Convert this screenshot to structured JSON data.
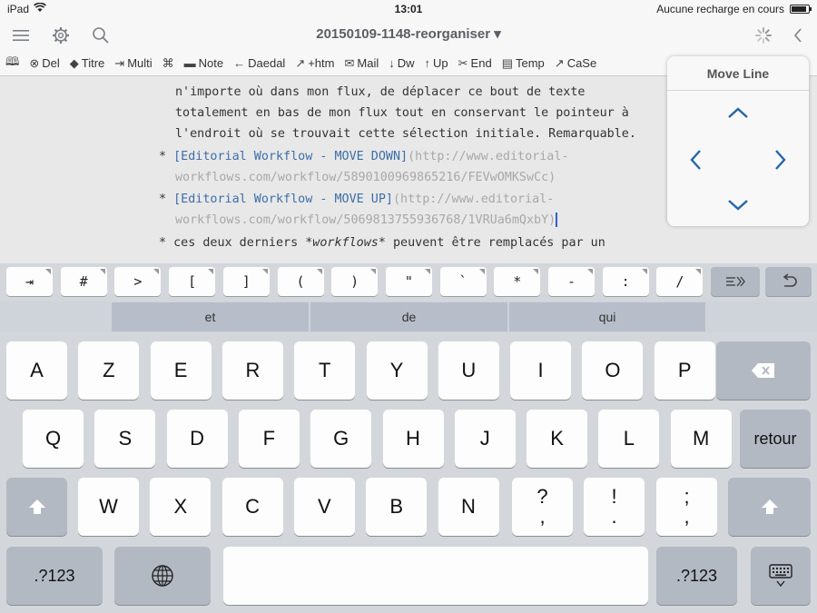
{
  "status": {
    "device": "iPad",
    "time": "13:01",
    "battery": "Aucune recharge en cours",
    "battery_fill": 0.9
  },
  "nav": {
    "title": "20150109-1148-reorganiser"
  },
  "toolbar": {
    "items": [
      {
        "icon": "book-icon",
        "label": ""
      },
      {
        "icon": "delete-circle-icon",
        "label": "Del"
      },
      {
        "icon": "tag-icon",
        "label": "Titre"
      },
      {
        "icon": "multi-icon",
        "label": "Multi"
      },
      {
        "icon": "edit-command-icon",
        "label": ""
      },
      {
        "icon": "speech-bubble-icon",
        "label": "Note"
      },
      {
        "icon": "back-arrow-icon",
        "label": "Daedal"
      },
      {
        "icon": "pin-icon",
        "label": "+htm"
      },
      {
        "icon": "mail-icon",
        "label": "Mail"
      },
      {
        "icon": "arrow-down-icon",
        "label": "Dw"
      },
      {
        "icon": "arrow-up-icon",
        "label": "Up"
      },
      {
        "icon": "scissors-icon",
        "label": "End"
      },
      {
        "icon": "clipboard-icon",
        "label": "Temp"
      },
      {
        "icon": "chart-icon",
        "label": "CaSe"
      }
    ]
  },
  "editor": {
    "line1": "n'importe où dans mon flux, de déplacer ce bout de texte",
    "line2": "totalement en bas de mon flux tout en conservant le pointeur à",
    "line3": "l'endroit où se trouvait cette sélection initiale. Remarquable.",
    "item1_bullet": "* ",
    "item1_link": "[Editorial Workflow - MOVE DOWN]",
    "item1_url_a": "(http://www.editorial-",
    "item1_url_b": "workflows.com/workflow/5890100969865216/FEVwOMKSwCc)",
    "item2_bullet": "* ",
    "item2_link": "[Editorial Workflow - MOVE UP]",
    "item2_url_a": "(http://www.editorial-",
    "item2_url_b": "workflows.com/workflow/5069813755936768/1VRUa6mQxbY)",
    "item3_bullet": "* ",
    "item3_pre": "ces deux derniers ",
    "item3_em": "*workflows*",
    "item3_post": " peuvent être remplacés par un"
  },
  "popover": {
    "title": "Move Line"
  },
  "accessory_keys": [
    "⇥",
    "#",
    ">",
    "[",
    "]",
    "(",
    ")",
    "\"",
    "`",
    "*",
    "-",
    ":",
    "/"
  ],
  "predictions": [
    "et",
    "de",
    "qui"
  ],
  "keyboard": {
    "row1": [
      "A",
      "Z",
      "E",
      "R",
      "T",
      "Y",
      "U",
      "I",
      "O",
      "P"
    ],
    "row2": [
      "Q",
      "S",
      "D",
      "F",
      "G",
      "H",
      "J",
      "K",
      "L",
      "M"
    ],
    "return_label": "retour",
    "row3": [
      "W",
      "X",
      "C",
      "V",
      "B",
      "N"
    ],
    "punct1_top": "?",
    "punct1_bottom": ",",
    "punct2_top": "!",
    "punct2_bottom": ".",
    "punct3_top": ";",
    "punct3_bottom": ",",
    "numbers_label": ".?123"
  }
}
